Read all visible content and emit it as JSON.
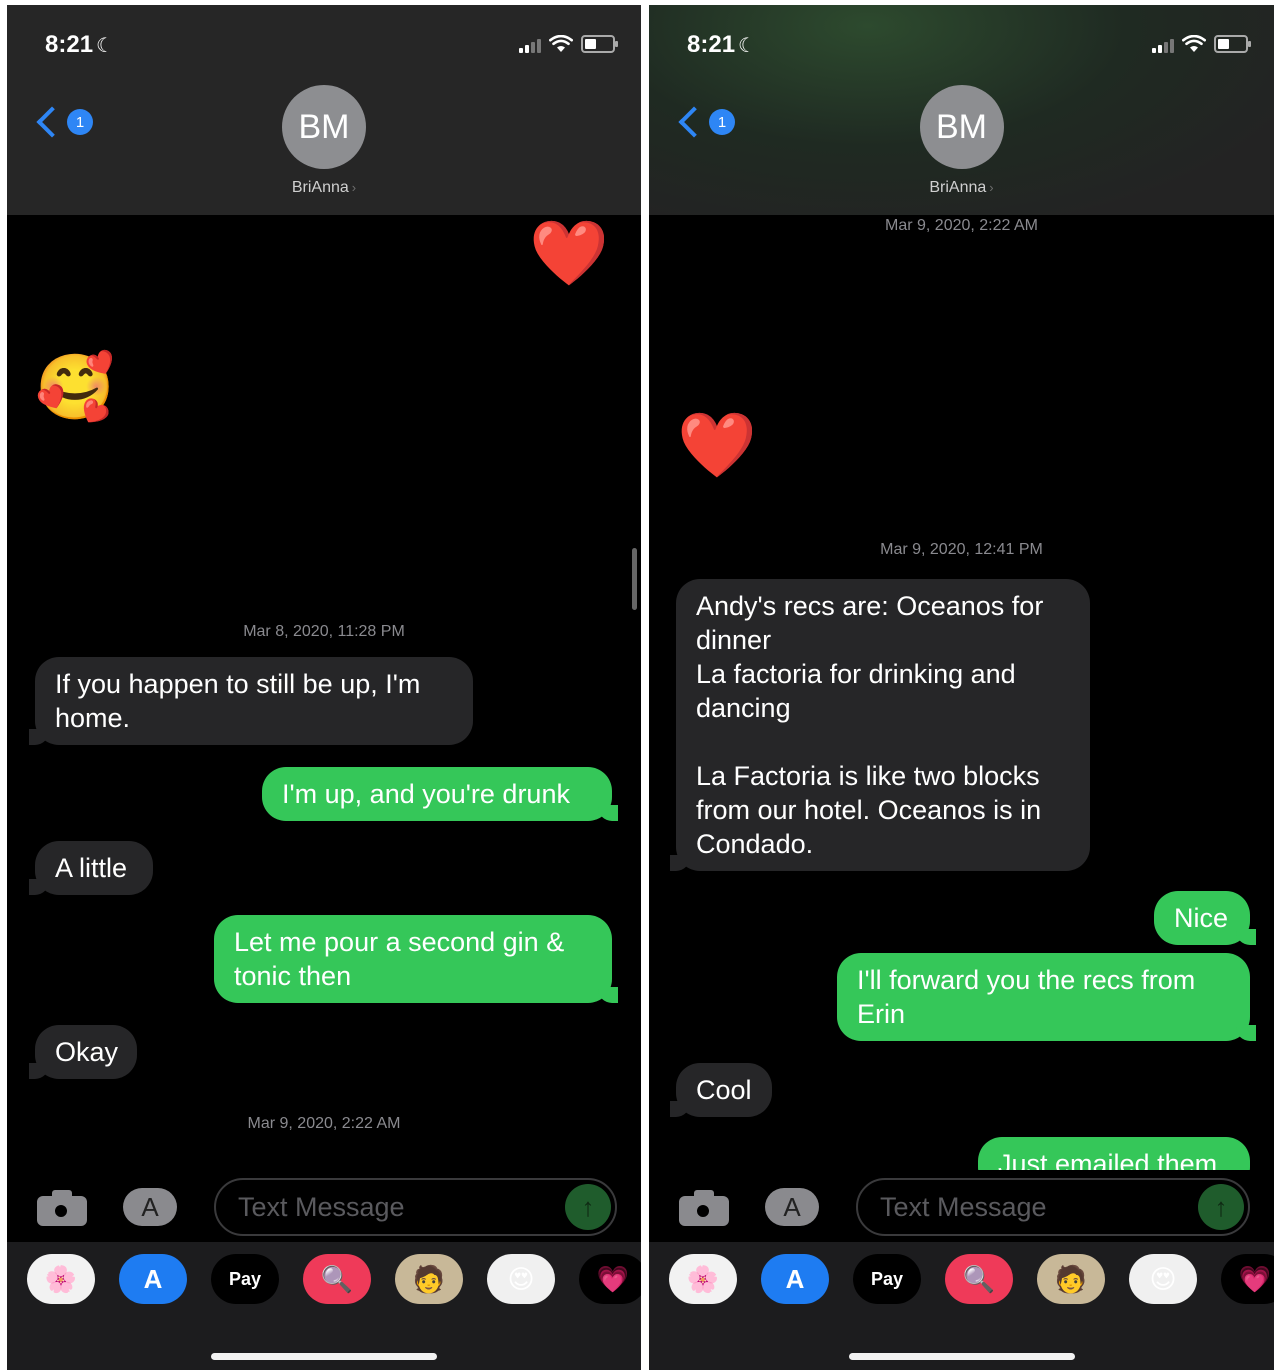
{
  "screens": [
    {
      "status": {
        "time": "8:21"
      },
      "header": {
        "back_badge": "1",
        "avatar_initials": "BM",
        "contact_name": "BriAnna",
        "contact_chevron": "›"
      },
      "messages": {
        "stamp1": "Mar 8, 2020, 11:28 PM",
        "m1": "If you happen to still be up, I'm home.",
        "m2": "I'm up, and you're drunk",
        "m3": "A little",
        "m4": "Let me pour a second gin & tonic then",
        "m5": "Okay",
        "stamp2": "Mar 9, 2020, 2:22 AM"
      },
      "emojis": {
        "heart": "❤️",
        "smiling_hearts": "🥰",
        "kiss": "😘"
      },
      "input": {
        "placeholder": "Text Message"
      }
    },
    {
      "status": {
        "time": "8:21"
      },
      "header": {
        "back_badge": "1",
        "avatar_initials": "BM",
        "contact_name": "BriAnna",
        "contact_chevron": "›"
      },
      "messages": {
        "stamp1": "Mar 9, 2020, 2:22 AM",
        "stamp2": "Mar 9, 2020, 12:41 PM",
        "m1": "Andy's recs are: Oceanos for dinner\nLa factoria for drinking and dancing\n\nLa Factoria is like two blocks from our hotel. Oceanos is in Condado.",
        "m2": "Nice",
        "m3": "I'll forward you the recs from Erin",
        "m4": "Cool",
        "m5": "Just emailed them"
      },
      "emojis": {
        "kiss": "😘",
        "heart": "❤️"
      },
      "input": {
        "placeholder": "Text Message"
      }
    }
  ],
  "drawer": {
    "pay_label": "Pay",
    "apple_glyph": "",
    "store_glyph": "A",
    "apps_glyph": "A"
  },
  "colors": {
    "sent": "#35c759",
    "received": "#262628",
    "accent": "#2e86f5"
  }
}
